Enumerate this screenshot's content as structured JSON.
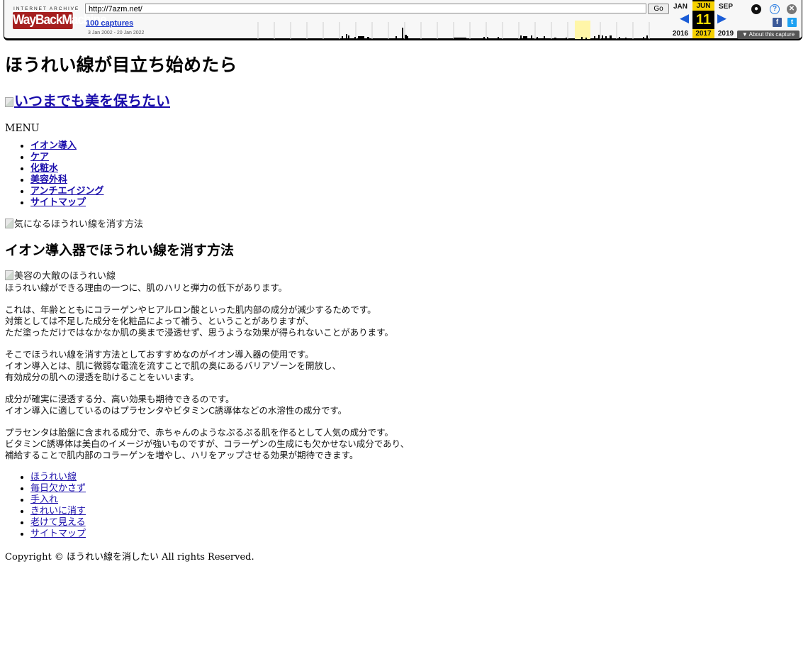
{
  "wayback": {
    "logo_small": "INTERNET ARCHIVE",
    "logo": "WayBackMachine",
    "url": "http://7azm.net/",
    "go_label": "Go",
    "captures": "100 captures",
    "range": "3 Jan 2002 - 20 Jan 2022",
    "prev_month": "JAN",
    "cur_month": "JUN",
    "next_month": "SEP",
    "cur_day": "11",
    "prev_year": "2016",
    "cur_year": "2017",
    "next_year": "2019",
    "about": "▼ About this capture",
    "icons": [
      "user-icon",
      "help-icon",
      "close-icon",
      "facebook-icon",
      "twitter-icon"
    ]
  },
  "page": {
    "title": "ほうれい線が目立ち始めたら",
    "logo_alt": "いつまでも美を保ちたい",
    "menu_label": "MENU",
    "nav": [
      "イオン導入",
      "ケア",
      "化粧水",
      "美容外科",
      "アンチエイジング",
      "サイトマップ"
    ],
    "hero_alt": "気になるほうれい線を消す方法",
    "article_title": "イオン導入器でほうれい線を消す方法",
    "article_img_alt": "美容の大敵のほうれい線",
    "paragraphs": [
      [
        "ほうれい線ができる理由の一つに、肌のハリと弾力の低下があります。"
      ],
      [
        "これは、年齢とともにコラーゲンやヒアルロン酸といった肌内部の成分が減少するためです。",
        "対策としては不足した成分を化粧品によって補う、ということがありますが、",
        "ただ塗っただけではなかなか肌の奥まで浸透せず、思うような効果が得られないことがあります。"
      ],
      [
        "そこでほうれい線を消す方法としておすすめなのがイオン導入器の使用です。",
        "イオン導入とは、肌に微弱な電流を流すことで肌の奥にあるバリアゾーンを開放し、",
        "有効成分の肌への浸透を助けることをいいます。"
      ],
      [
        "成分が確実に浸透する分、高い効果も期待できるのです。",
        "イオン導入に適しているのはプラセンタやビタミンC誘導体などの水溶性の成分です。"
      ],
      [
        "プラセンタは胎盤に含まれる成分で、赤ちゃんのようなぷるぷる肌を作るとして人気の成分です。",
        "ビタミンC誘導体は美白のイメージが強いものですが、コラーゲンの生成にも欠かせない成分であり、",
        "補給することで肌内部のコラーゲンを増やし、ハリをアップさせる効果が期待できます。"
      ]
    ],
    "tags": [
      "ほうれい線",
      "毎日欠かさず",
      "手入れ",
      "きれいに消す",
      "老けて見える",
      "サイトマップ"
    ],
    "copyright": "Copyright © ほうれい線を消したい All rights Reserved."
  }
}
